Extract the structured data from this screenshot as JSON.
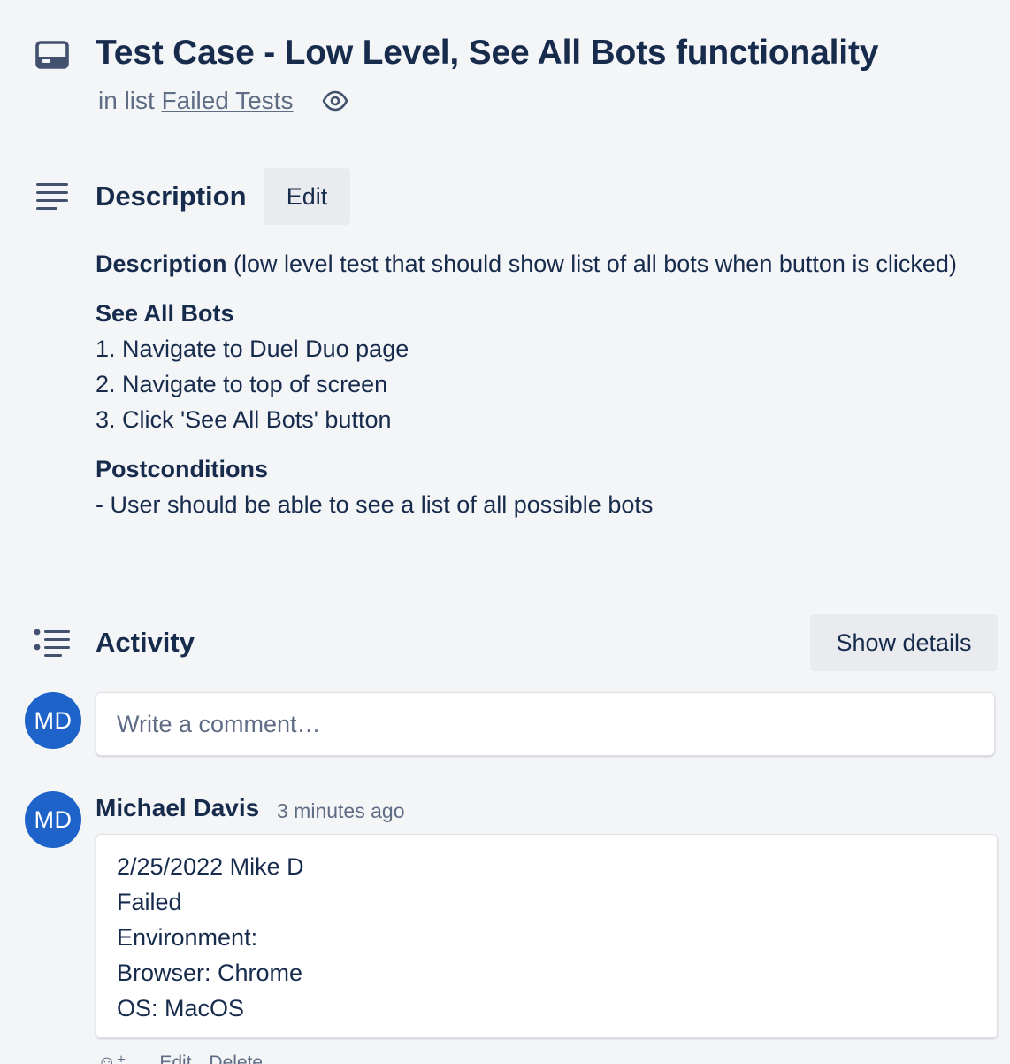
{
  "card": {
    "title": "Test Case - Low Level, See All Bots functionality",
    "in_list_prefix": "in list",
    "list_name": "Failed Tests"
  },
  "description": {
    "section_title": "Description",
    "edit_label": "Edit",
    "intro_bold": "Description",
    "intro_text": " (low level test that should show list of all bots when button is clicked)",
    "steps_heading": "See All Bots",
    "steps": [
      "1. Navigate to Duel Duo page",
      "2. Navigate to top of screen",
      "3. Click 'See All Bots' button"
    ],
    "post_heading": "Postconditions",
    "post_items": [
      "- User should be able to see a list of all possible bots"
    ]
  },
  "activity": {
    "section_title": "Activity",
    "show_details_label": "Show details",
    "current_user_initials": "MD",
    "comment_placeholder": "Write a comment…",
    "comments": [
      {
        "initials": "MD",
        "author": "Michael Davis",
        "timestamp": "3 minutes ago",
        "lines": [
          "2/25/2022 Mike D",
          "Failed",
          "Environment:",
          "Browser: Chrome",
          "OS: MacOS"
        ],
        "actions": [
          "Edit",
          "Delete"
        ]
      }
    ]
  },
  "icons": {
    "card": "card-icon",
    "watch": "eye-icon",
    "description": "text-lines-icon",
    "activity": "list-bullets-icon",
    "reaction": "add-reaction-icon"
  },
  "colors": {
    "background": "#f4f5f7",
    "text": "#172b4d",
    "muted": "#5e6c84",
    "avatar": "#1e63c9",
    "button": "#e9ebee"
  }
}
